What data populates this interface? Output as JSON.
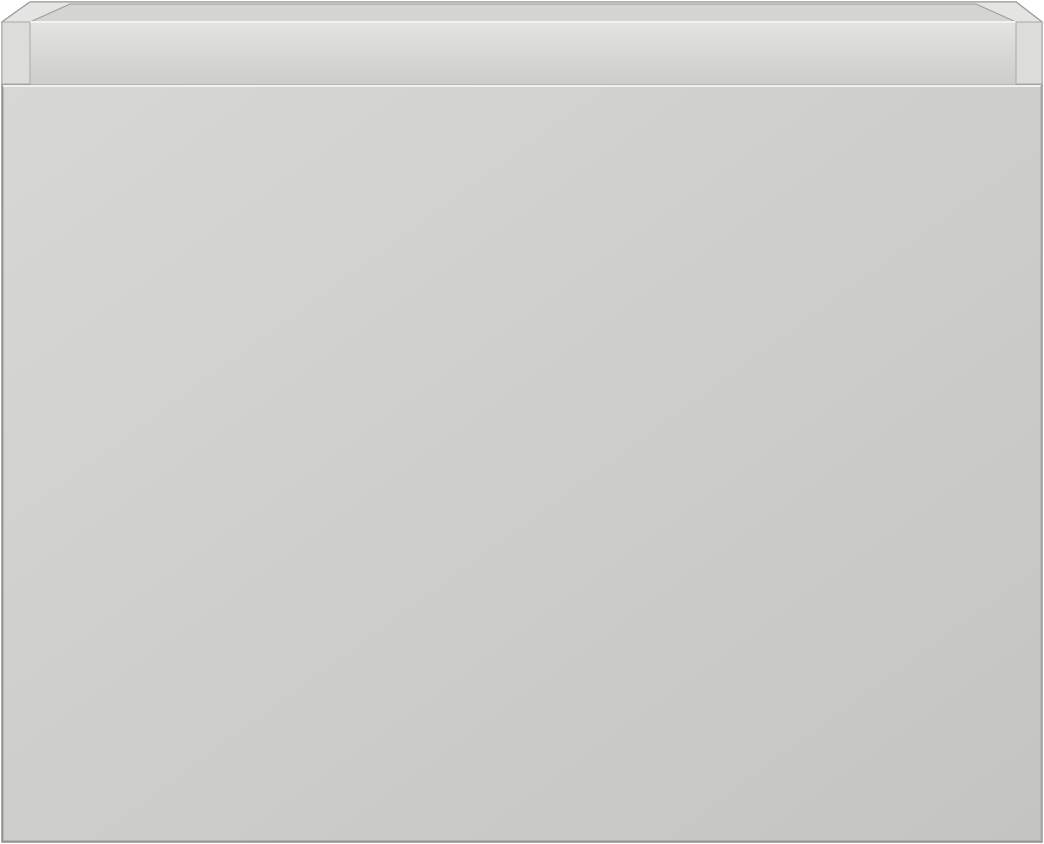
{
  "image": {
    "subject": "drawer-cabinet-front",
    "colors": {
      "background": "#ffffff",
      "panel_light": "#d6d6d4",
      "panel_dark": "#c5c5c3",
      "rim_top": "#e6e6e4",
      "inner_back": "#cfcfcd",
      "inner_floor": "#d2d2d0",
      "edge_highlight": "#f2f2f0",
      "edge_shadow": "#a9a9a7",
      "outline": "#8f8f8d"
    }
  }
}
